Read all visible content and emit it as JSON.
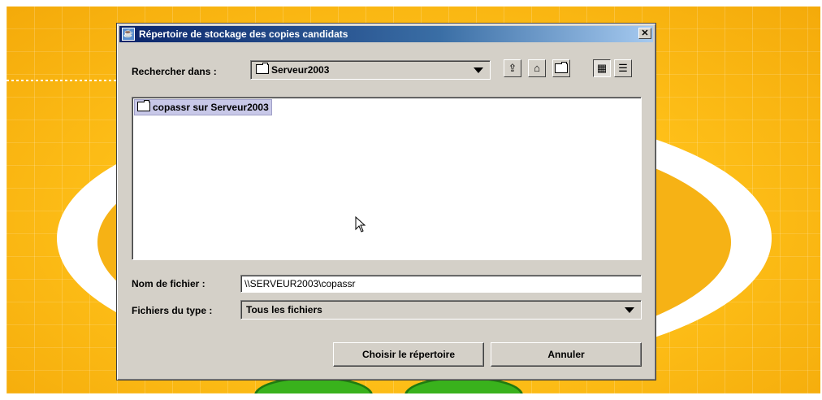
{
  "dialog": {
    "title": "Répertoire de stockage des copies candidats",
    "close_glyph": "✕",
    "look_in": {
      "label": "Rechercher dans :",
      "value": "Serveur2003"
    },
    "toolbar": {
      "up_icon": "up-folder-icon",
      "home_icon": "home-icon",
      "new_folder_icon": "new-folder-icon",
      "list_view_icon": "list-view-icon",
      "details_view_icon": "details-view-icon"
    },
    "files": [
      {
        "name": "copassr sur Serveur2003",
        "icon": "folder-icon",
        "selected": true
      }
    ],
    "file_name": {
      "label": "Nom de fichier :",
      "value": "\\\\SERVEUR2003\\copassr"
    },
    "file_type": {
      "label": "Fichiers du type :",
      "value": "Tous les fichiers"
    },
    "buttons": {
      "choose": "Choisir le répertoire",
      "cancel": "Annuler"
    }
  },
  "colors": {
    "titlebar_start": "#0a246a",
    "dialog_bg": "#d4d0c8",
    "selection": "#c8c8e8",
    "background_yellow": "#ffc21a"
  }
}
